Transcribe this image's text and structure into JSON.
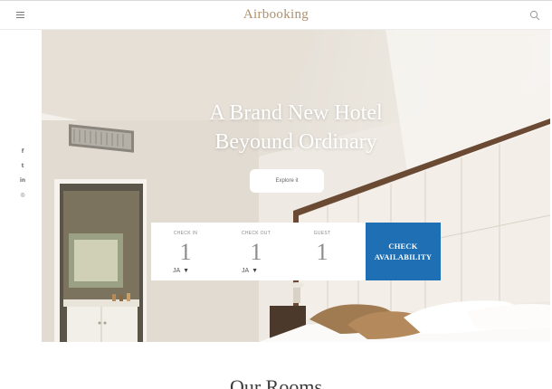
{
  "header": {
    "brand": "Airbooking",
    "menu_icon": "menu-icon",
    "search_icon": "search-icon"
  },
  "social": [
    {
      "icon": "facebook-icon",
      "glyph": "f"
    },
    {
      "icon": "twitter-icon",
      "glyph": "t"
    },
    {
      "icon": "linkedin-icon",
      "glyph": "in"
    },
    {
      "icon": "instagram-icon",
      "glyph": "◎"
    }
  ],
  "hero": {
    "title_line1": "A Brand New Hotel",
    "title_line2": "Beyound Ordinary",
    "explore_label": "Explore it"
  },
  "booking": {
    "check_in": {
      "label": "CHECK IN",
      "day": "1",
      "month": "JA"
    },
    "check_out": {
      "label": "CHECK OUT",
      "day": "1",
      "month": "JA"
    },
    "guest": {
      "label": "GUEST",
      "count": "1"
    },
    "button_line1": "CHECK",
    "button_line2": "AVAILABILITY",
    "button_color": "#1f6fb4"
  },
  "section": {
    "title": "Our Rooms"
  },
  "colors": {
    "brand": "#b0906a",
    "accent": "#1f6fb4"
  }
}
